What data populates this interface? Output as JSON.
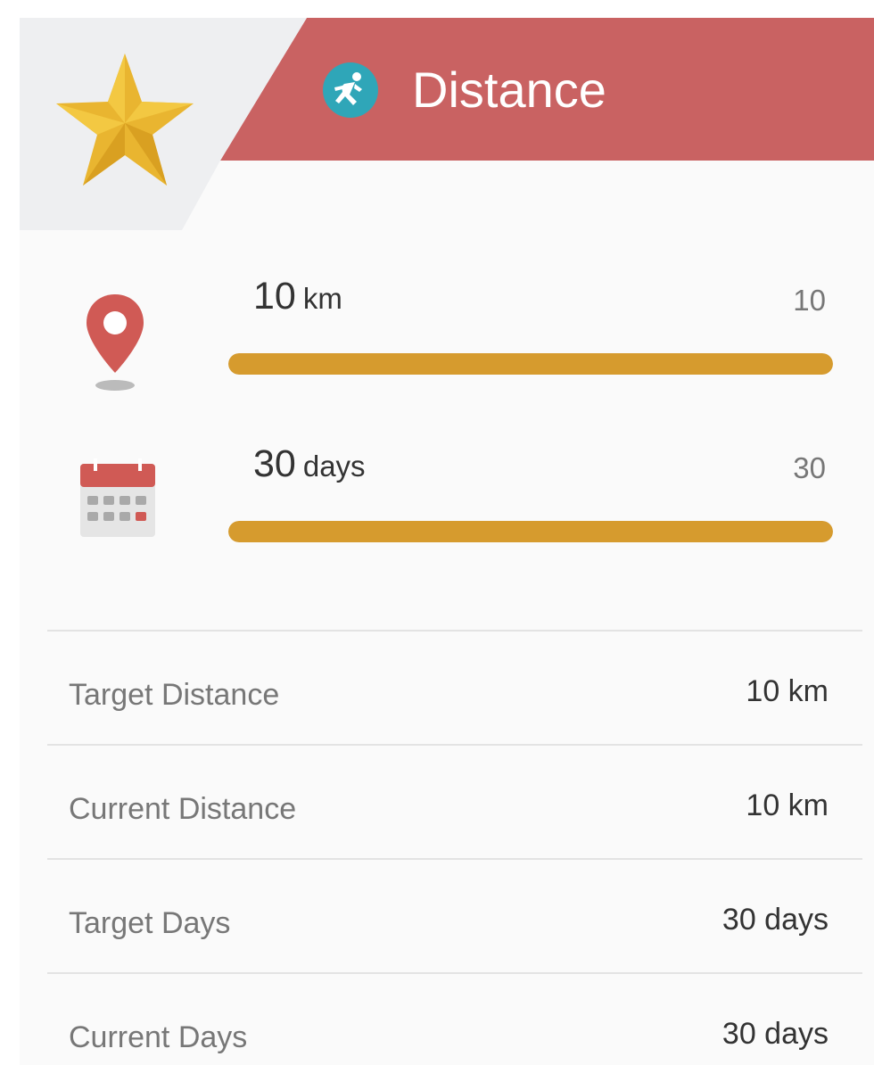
{
  "header": {
    "title": "Distance",
    "badge_icon": "star-icon",
    "title_icon": "runner-icon",
    "accent_color": "#c96262"
  },
  "goals": [
    {
      "icon": "map-pin-icon",
      "amount": "10",
      "unit": "km",
      "max": "10",
      "progress": 1.0,
      "bar_color": "#d69b2e"
    },
    {
      "icon": "calendar-icon",
      "amount": "30",
      "unit": "days",
      "max": "30",
      "progress": 1.0,
      "bar_color": "#d69b2e"
    }
  ],
  "stats": [
    {
      "label": "Target Distance",
      "value": "10 km"
    },
    {
      "label": "Current Distance",
      "value": "10 km"
    },
    {
      "label": "Target Days",
      "value": "30 days"
    },
    {
      "label": "Current Days",
      "value": "30 days"
    }
  ]
}
